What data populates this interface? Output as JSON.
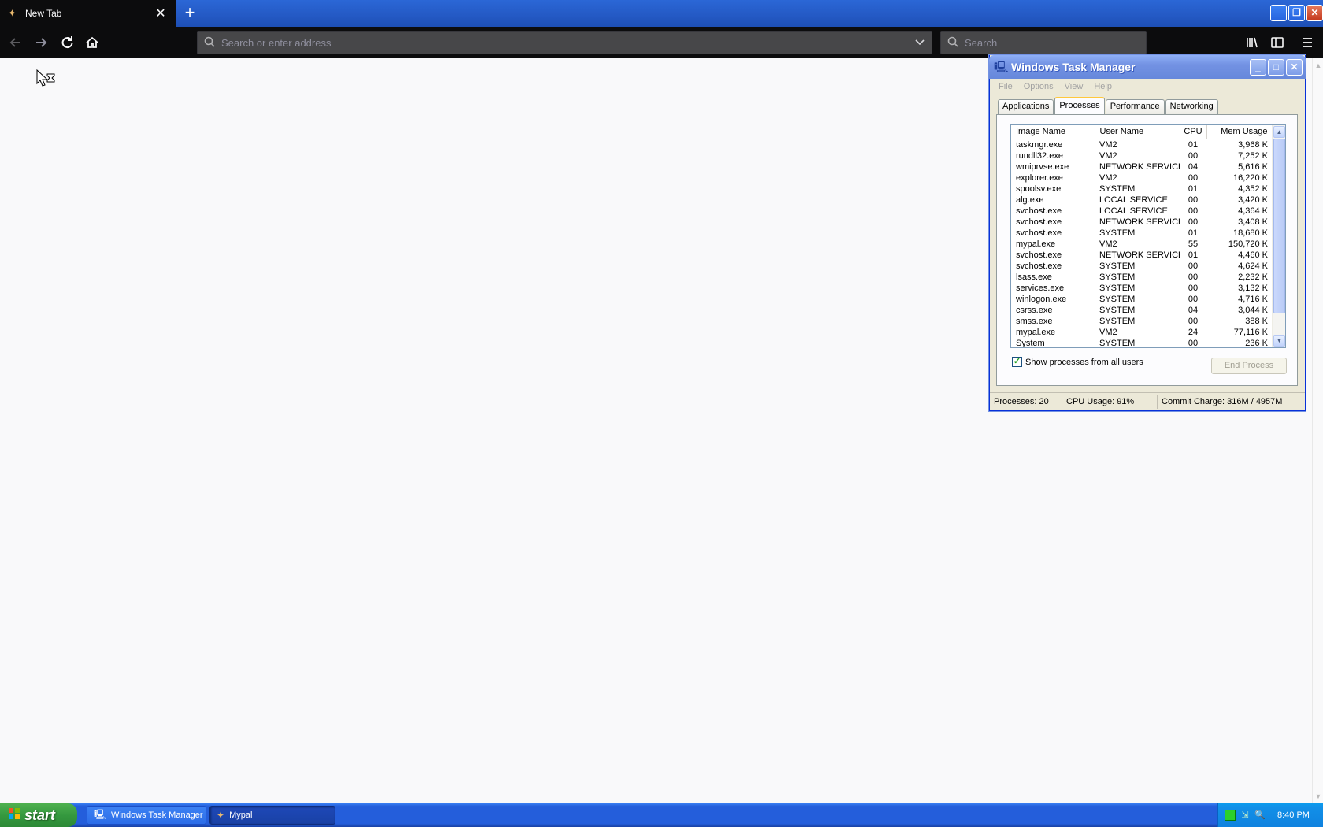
{
  "browser": {
    "tab": {
      "title": "New Tab",
      "close_glyph": "✕"
    },
    "new_tab_glyph": "+",
    "url_placeholder": "Search or enter address",
    "search_placeholder": "Search"
  },
  "taskmgr": {
    "title": "Windows Task Manager",
    "menu": [
      "File",
      "Options",
      "View",
      "Help"
    ],
    "tabs": [
      "Applications",
      "Processes",
      "Performance",
      "Networking"
    ],
    "active_tab": "Processes",
    "columns": [
      "Image Name",
      "User Name",
      "CPU",
      "Mem Usage"
    ],
    "processes": [
      {
        "name": "taskmgr.exe",
        "user": "VM2",
        "cpu": "01",
        "mem": "3,968 K"
      },
      {
        "name": "rundll32.exe",
        "user": "VM2",
        "cpu": "00",
        "mem": "7,252 K"
      },
      {
        "name": "wmiprvse.exe",
        "user": "NETWORK SERVICE",
        "cpu": "04",
        "mem": "5,616 K"
      },
      {
        "name": "explorer.exe",
        "user": "VM2",
        "cpu": "00",
        "mem": "16,220 K"
      },
      {
        "name": "spoolsv.exe",
        "user": "SYSTEM",
        "cpu": "01",
        "mem": "4,352 K"
      },
      {
        "name": "alg.exe",
        "user": "LOCAL SERVICE",
        "cpu": "00",
        "mem": "3,420 K"
      },
      {
        "name": "svchost.exe",
        "user": "LOCAL SERVICE",
        "cpu": "00",
        "mem": "4,364 K"
      },
      {
        "name": "svchost.exe",
        "user": "NETWORK SERVICE",
        "cpu": "00",
        "mem": "3,408 K"
      },
      {
        "name": "svchost.exe",
        "user": "SYSTEM",
        "cpu": "01",
        "mem": "18,680 K"
      },
      {
        "name": "mypal.exe",
        "user": "VM2",
        "cpu": "55",
        "mem": "150,720 K"
      },
      {
        "name": "svchost.exe",
        "user": "NETWORK SERVICE",
        "cpu": "01",
        "mem": "4,460 K"
      },
      {
        "name": "svchost.exe",
        "user": "SYSTEM",
        "cpu": "00",
        "mem": "4,624 K"
      },
      {
        "name": "lsass.exe",
        "user": "SYSTEM",
        "cpu": "00",
        "mem": "2,232 K"
      },
      {
        "name": "services.exe",
        "user": "SYSTEM",
        "cpu": "00",
        "mem": "3,132 K"
      },
      {
        "name": "winlogon.exe",
        "user": "SYSTEM",
        "cpu": "00",
        "mem": "4,716 K"
      },
      {
        "name": "csrss.exe",
        "user": "SYSTEM",
        "cpu": "04",
        "mem": "3,044 K"
      },
      {
        "name": "smss.exe",
        "user": "SYSTEM",
        "cpu": "00",
        "mem": "388 K"
      },
      {
        "name": "mypal.exe",
        "user": "VM2",
        "cpu": "24",
        "mem": "77,116 K"
      },
      {
        "name": "System",
        "user": "SYSTEM",
        "cpu": "00",
        "mem": "236 K"
      }
    ],
    "show_all_label": "Show processes from all users",
    "show_all_checked": true,
    "end_process_label": "End Process",
    "status": {
      "processes": "Processes: 20",
      "cpu": "CPU Usage: 91%",
      "commit": "Commit Charge: 316M / 4957M"
    }
  },
  "taskbar": {
    "start_label": "start",
    "tasks": [
      {
        "label": "Windows Task Manager",
        "icon": "monitor-icon"
      },
      {
        "label": "Mypal",
        "icon": "mypal-icon"
      }
    ],
    "clock": "8:40 PM"
  }
}
